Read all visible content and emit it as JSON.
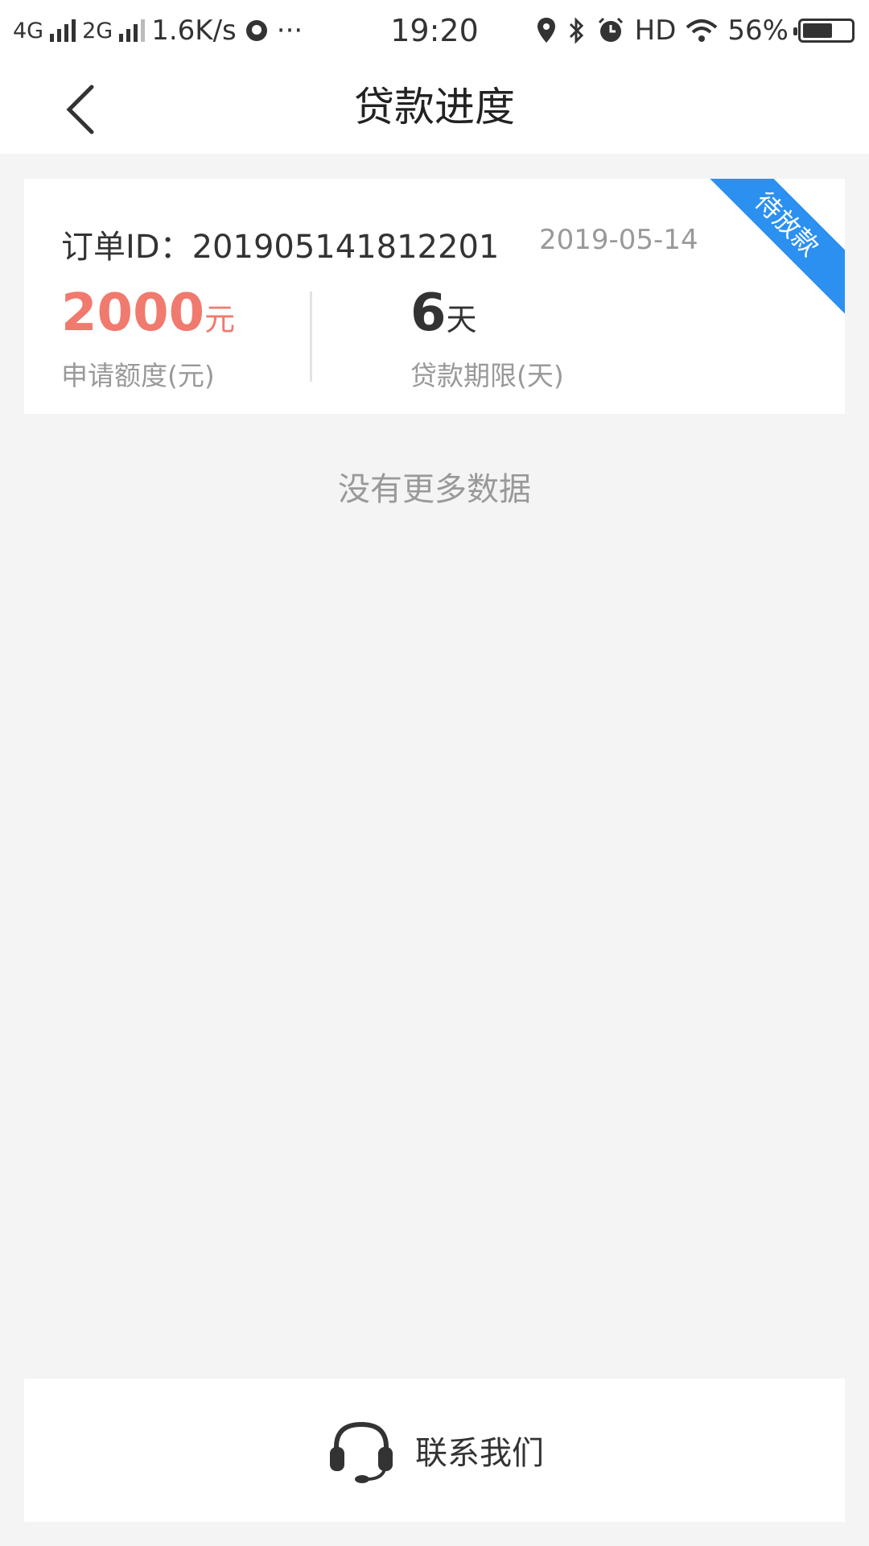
{
  "status_bar": {
    "network1": "4G",
    "network2": "2G",
    "speed": "1.6K/s",
    "more": "···",
    "time": "19:20",
    "hd": "HD",
    "battery": "56%"
  },
  "header": {
    "title": "贷款进度"
  },
  "order": {
    "id_label": "订单ID：",
    "id_value": "201905141812201",
    "date": "2019-05-14",
    "status_badge": "待放款",
    "amount_value": "2000",
    "amount_unit": "元",
    "amount_label": "申请额度(元)",
    "term_value": "6",
    "term_unit": "天",
    "term_label": "贷款期限(天)"
  },
  "list": {
    "end_text": "没有更多数据"
  },
  "footer": {
    "contact_label": "联系我们"
  },
  "colors": {
    "accent_red": "#f07a6e",
    "badge_blue": "#2b90f0"
  }
}
